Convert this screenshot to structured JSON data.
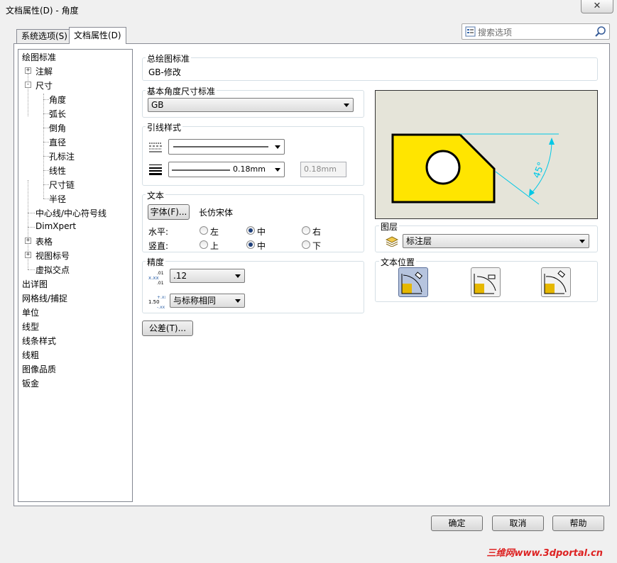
{
  "window": {
    "title": "文档属性(D) - 角度",
    "close_glyph": "✕"
  },
  "tabs": [
    {
      "label": "系统选项(S)",
      "active": false
    },
    {
      "label": "文档属性(D)",
      "active": true
    }
  ],
  "search": {
    "placeholder": "搜索选项"
  },
  "tree": {
    "items": [
      {
        "label": "绘图标准"
      },
      {
        "label": "注解",
        "expander": "+"
      },
      {
        "label": "尺寸",
        "expander": "-"
      },
      {
        "label": "角度"
      },
      {
        "label": "弧长"
      },
      {
        "label": "倒角"
      },
      {
        "label": "直径"
      },
      {
        "label": "孔标注"
      },
      {
        "label": "线性"
      },
      {
        "label": "尺寸链"
      },
      {
        "label": "半径"
      },
      {
        "label": "中心线/中心符号线"
      },
      {
        "label": "DimXpert"
      },
      {
        "label": "表格",
        "expander": "+"
      },
      {
        "label": "视图标号",
        "expander": "+"
      },
      {
        "label": "虚拟交点"
      },
      {
        "label": "出详图"
      },
      {
        "label": "网格线/捕捉"
      },
      {
        "label": "单位"
      },
      {
        "label": "线型"
      },
      {
        "label": "线条样式"
      },
      {
        "label": "线粗"
      },
      {
        "label": "图像品质"
      },
      {
        "label": "钣金"
      }
    ]
  },
  "overall_standard": {
    "label": "总绘图标准",
    "value": "GB-修改"
  },
  "angle_standard": {
    "label": "基本角度尺寸标准",
    "value": "GB"
  },
  "leader_style": {
    "label": "引线样式",
    "thickness_value": "0.18mm",
    "custom_value": "0.18mm"
  },
  "text": {
    "label": "文本",
    "font_button": "字体(F)...",
    "font_name": "长仿宋体",
    "horizontal_label": "水平:",
    "vertical_label": "竖直:",
    "h_options": [
      "左",
      "中",
      "右"
    ],
    "h_selected": 1,
    "v_options": [
      "上",
      "中",
      "下"
    ],
    "v_selected": 1
  },
  "precision": {
    "label": "精度",
    "primary_value": ".12",
    "tolerance_value": "与标称相同"
  },
  "tolerance_button": "公差(T)...",
  "preview": {
    "angle_text": "45°",
    "colors": {
      "part_fill": "#ffe500",
      "dim": "#00c8e6"
    }
  },
  "layer": {
    "label": "图层",
    "value": "标注层"
  },
  "text_position": {
    "label": "文本位置",
    "selected": 0
  },
  "buttons": {
    "ok": "确定",
    "cancel": "取消",
    "help": "帮助"
  },
  "watermark": "三维网www.3dportal.cn"
}
